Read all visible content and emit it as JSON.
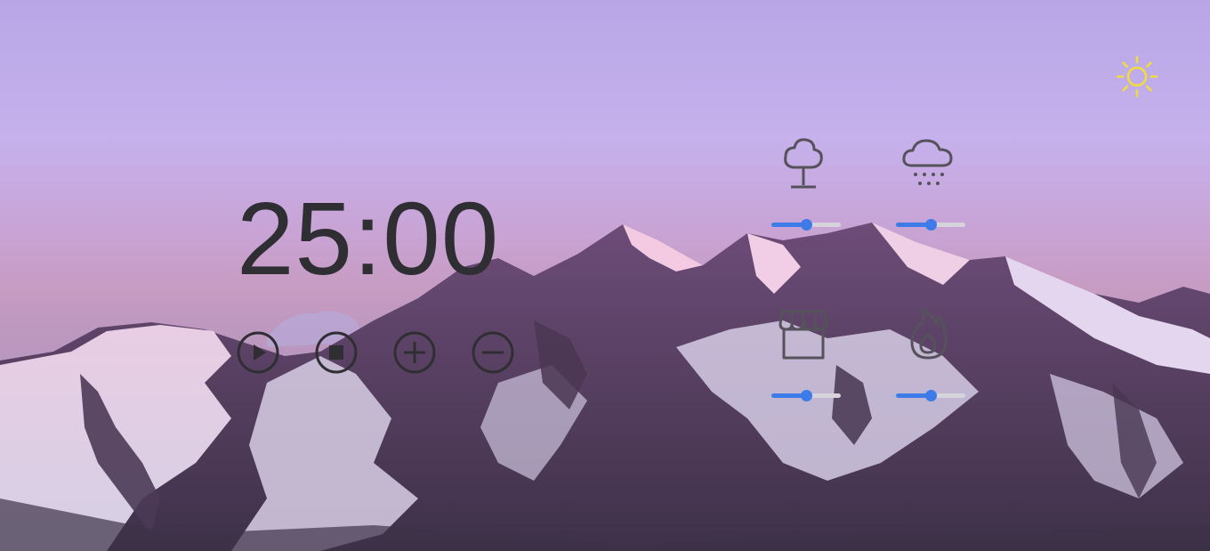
{
  "app": {
    "timer_display": "25:00"
  },
  "theme": {
    "icon": "sun-icon",
    "color": "#f1dd3a"
  },
  "controls": [
    {
      "name": "play",
      "icon": "play-icon"
    },
    {
      "name": "stop",
      "icon": "stop-icon"
    },
    {
      "name": "increase",
      "icon": "plus-icon"
    },
    {
      "name": "decrease",
      "icon": "minus-icon"
    }
  ],
  "sounds": [
    {
      "name": "forest",
      "icon": "tree-icon",
      "volume": 0.5
    },
    {
      "name": "rain",
      "icon": "rain-cloud-icon",
      "volume": 0.5
    },
    {
      "name": "cafe",
      "icon": "storefront-icon",
      "volume": 0.5
    },
    {
      "name": "fireplace",
      "icon": "fire-icon",
      "volume": 0.5
    }
  ],
  "colors": {
    "accent": "#3c7be8",
    "track": "#d6d3da",
    "text": "#2f2f33",
    "icon": "#55525c"
  }
}
